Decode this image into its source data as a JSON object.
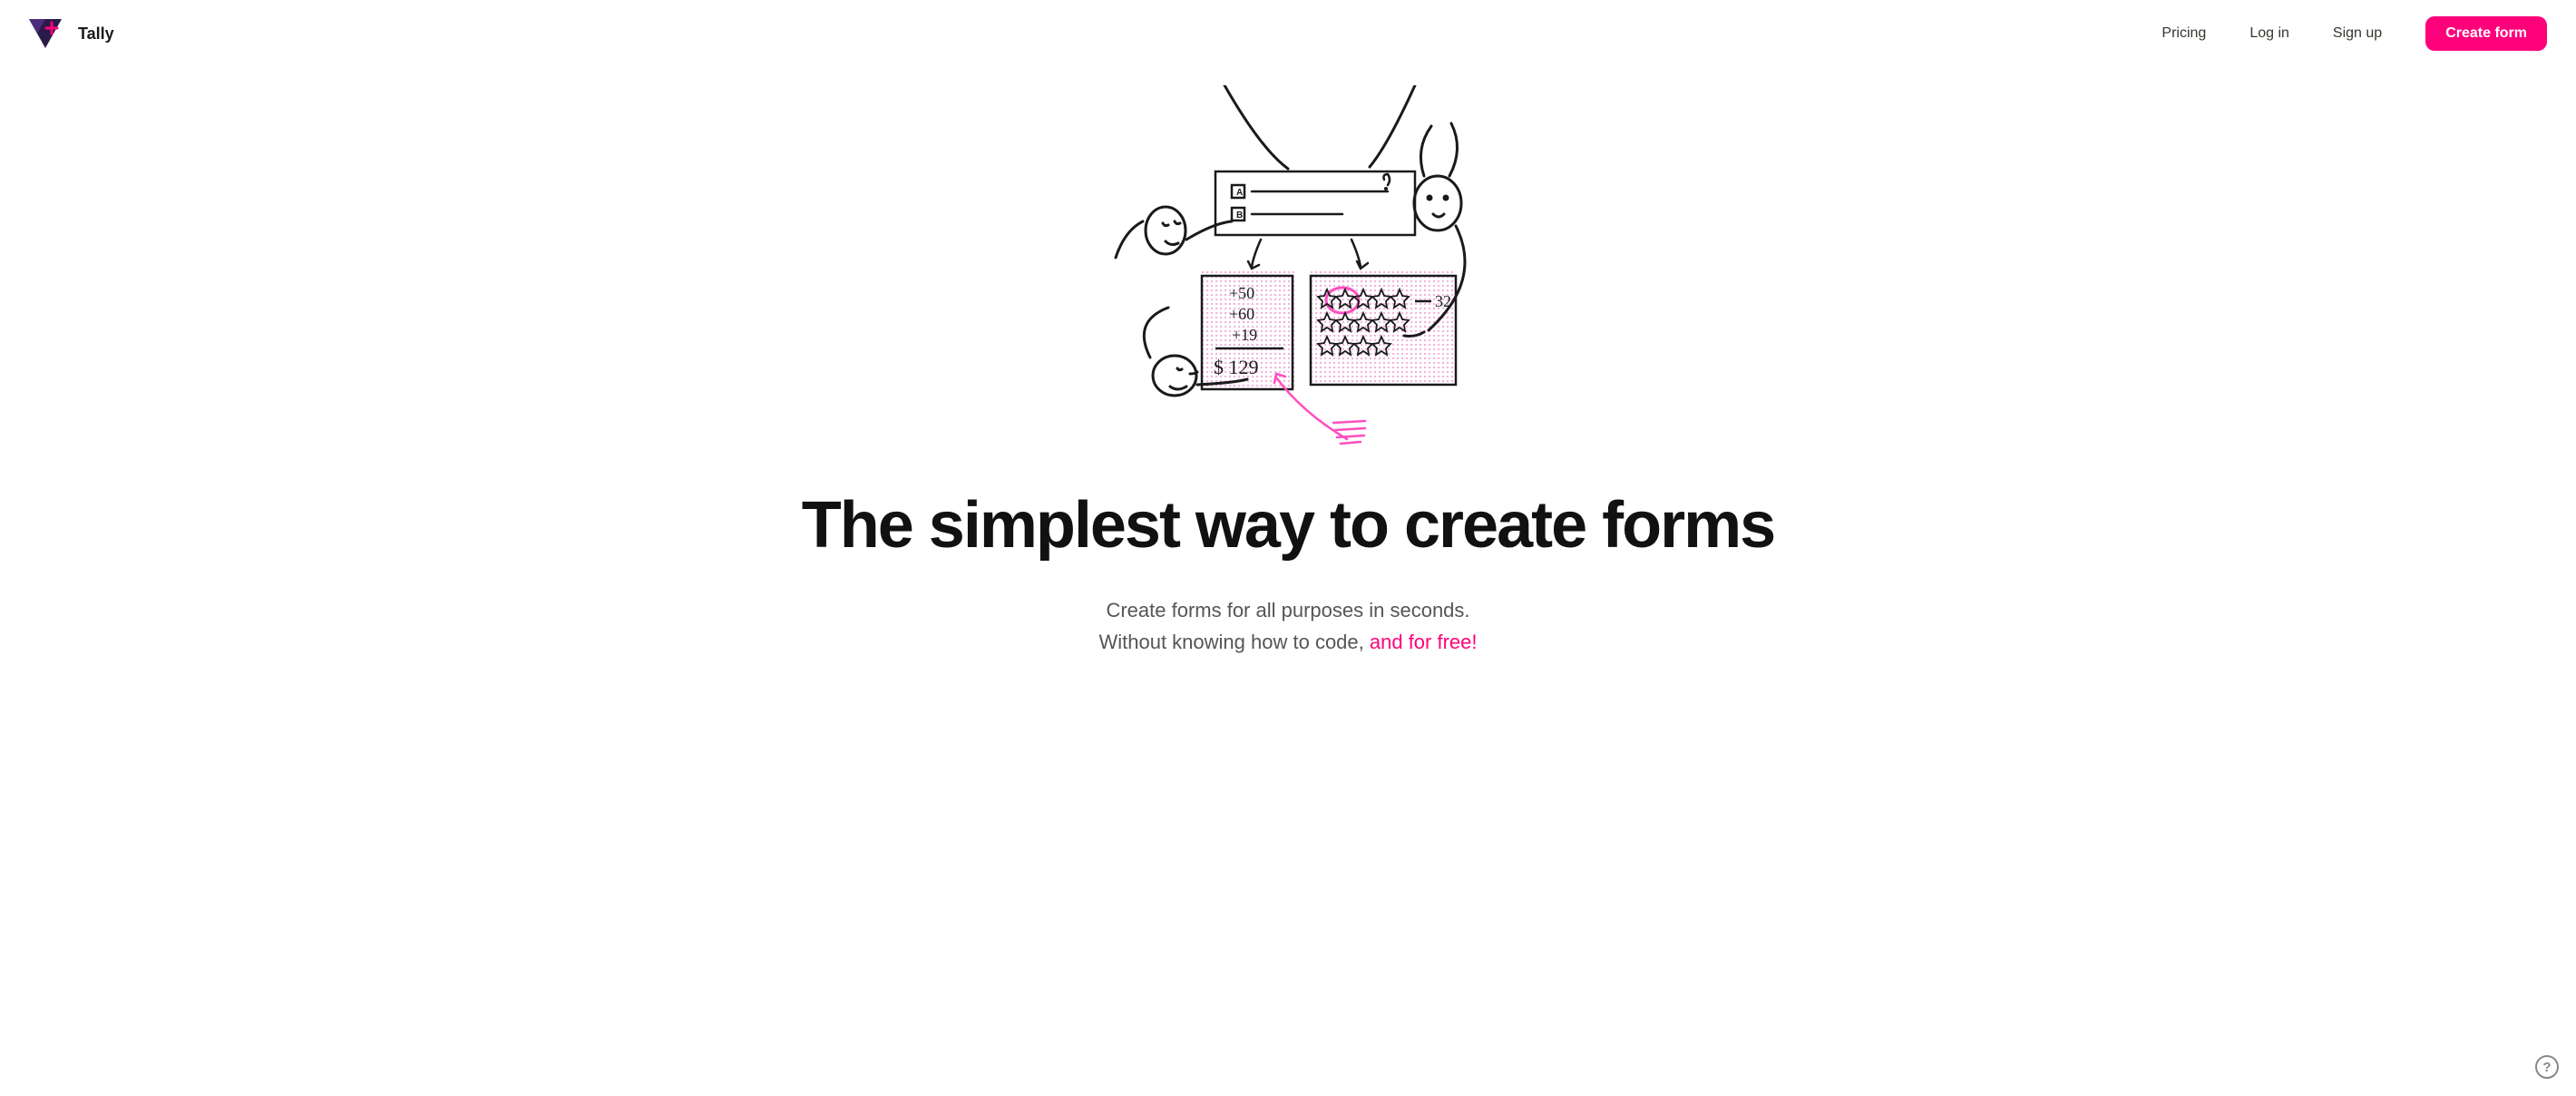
{
  "brand": {
    "name": "Tally"
  },
  "nav": {
    "pricing": "Pricing",
    "login": "Log in",
    "signup": "Sign up",
    "cta": "Create form"
  },
  "hero": {
    "title": "The simplest way to create forms",
    "sub_line1": "Create forms for all purposes in seconds.",
    "sub_line2_prefix": "Without knowing how to code, ",
    "sub_line2_emphasis": "and for free!"
  },
  "illustration": {
    "math_lines": [
      "+50",
      "+60",
      "+19"
    ],
    "math_total": "$ 129",
    "rating_label": "32",
    "option_a": "A",
    "option_b": "B"
  },
  "help": {
    "label": "?"
  }
}
